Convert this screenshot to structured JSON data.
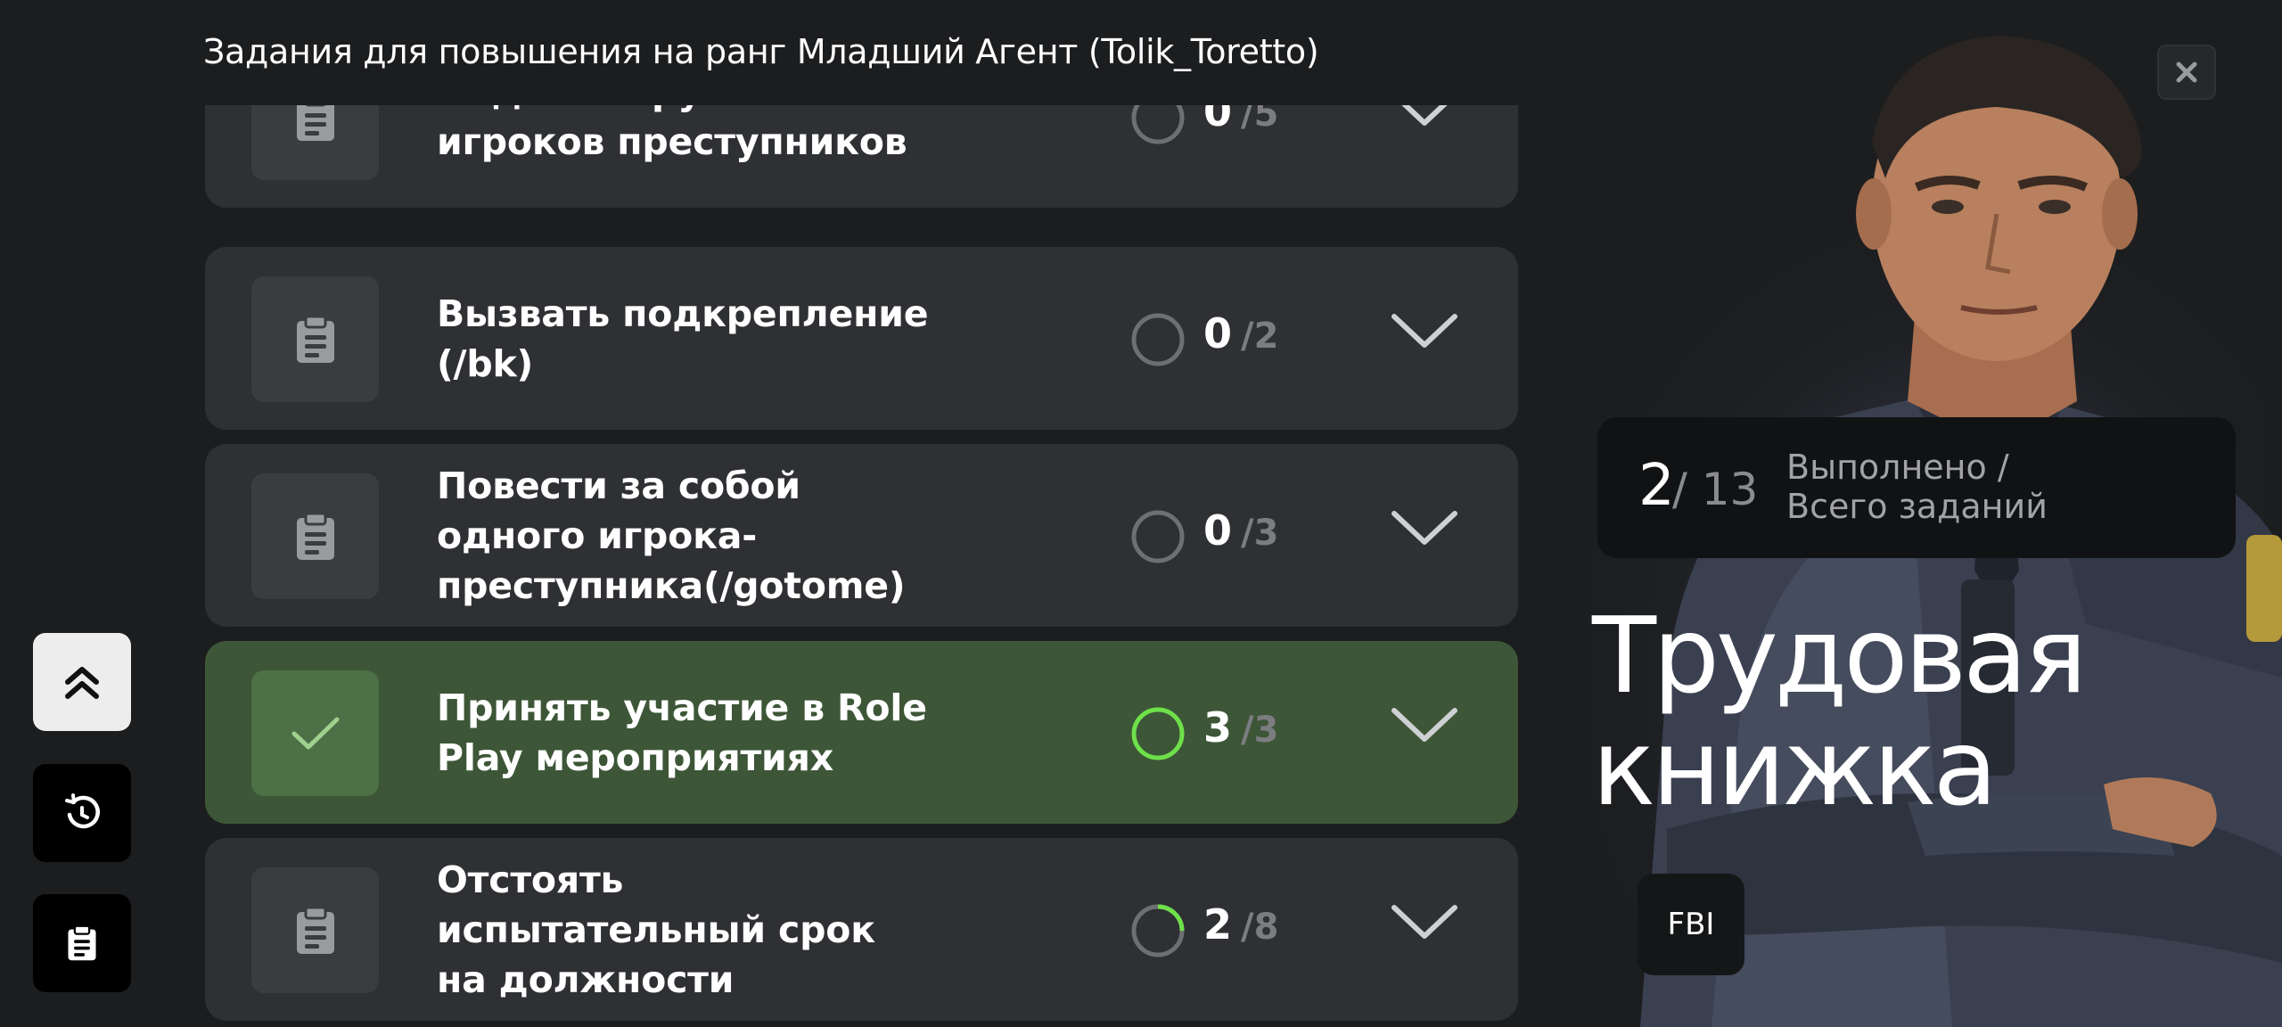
{
  "header": {
    "title": "Задания для повышения на ранг  Младший Агент (Tolik_Toretto)"
  },
  "tasks": [
    {
      "name": "Надеть наручники на игроков преступников",
      "current": "0",
      "total": "/5",
      "done": false,
      "progress": 0.0
    },
    {
      "name": "Вызвать подкрепление (/bk)",
      "current": "0",
      "total": "/2",
      "done": false,
      "progress": 0.0
    },
    {
      "name": "Повести за собой одного игрока-преступника(/gotome)",
      "current": "0",
      "total": "/3",
      "done": false,
      "progress": 0.0
    },
    {
      "name": "Принять участие в Role Play мероприятиях",
      "current": "3",
      "total": "/3",
      "done": true,
      "progress": 1.0
    },
    {
      "name": "Отстоять испытательный срок на должности",
      "current": "2",
      "total": "/8",
      "done": false,
      "progress": 0.25
    }
  ],
  "stats": {
    "completed": "2",
    "total": "/ 13",
    "label": "Выполнено / Всего заданий"
  },
  "book_title": "Трудовая книжка",
  "organization": "FBI",
  "icons": {
    "close": "close-icon",
    "task": "clipboard-icon",
    "done": "check-icon",
    "expand": "chevron-down-icon",
    "scroll_top": "double-chevron-up-icon",
    "reset": "timer-reset-icon",
    "tasks_nav": "clipboard-icon"
  },
  "colors": {
    "background": "#1c1d1f",
    "card": "#2f3033",
    "card_done": "#3d5637",
    "ring_done": "#6ee04a",
    "ring_empty": "#6e6f72"
  }
}
